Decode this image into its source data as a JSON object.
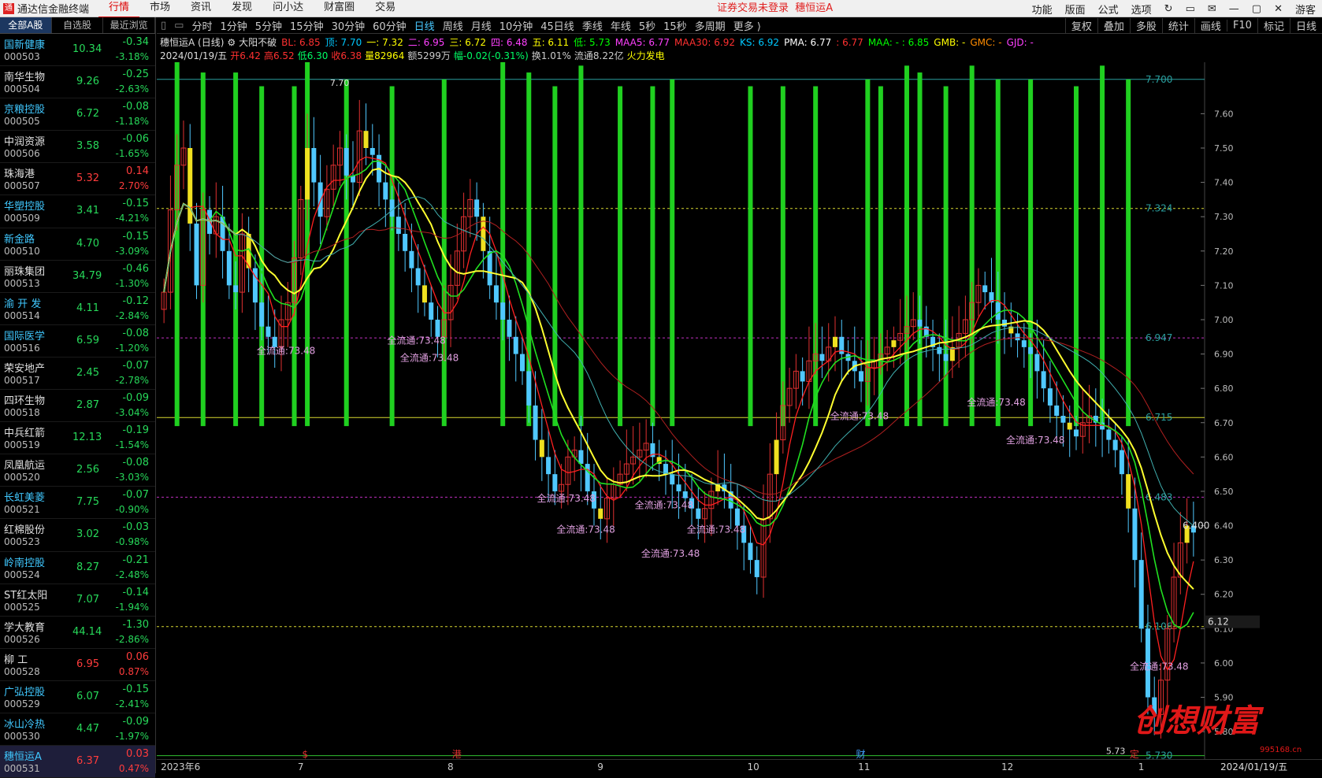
{
  "app": {
    "title": "通达信金融终端",
    "logo": "通"
  },
  "menu": [
    "行情",
    "市场",
    "资讯",
    "发现",
    "问小达",
    "财富圈",
    "交易"
  ],
  "notice": {
    "text": "证券交易未登录",
    "stock": "穗恒运A"
  },
  "right_menu": [
    "功能",
    "版面",
    "公式",
    "选项",
    "游客"
  ],
  "side_tabs": [
    "全部A股",
    "自选股",
    "最近浏览"
  ],
  "stocks": [
    {
      "name": "国新健康",
      "code": "000503",
      "price": "10.34",
      "change": "-0.34",
      "pct": "-3.18%",
      "highlight": true
    },
    {
      "name": "南华生物",
      "code": "000504",
      "price": "9.26",
      "change": "-0.25",
      "pct": "-2.63%"
    },
    {
      "name": "京粮控股",
      "code": "000505",
      "price": "6.72",
      "change": "-0.08",
      "pct": "-1.18%",
      "highlight": true
    },
    {
      "name": "中润资源",
      "code": "000506",
      "price": "3.58",
      "change": "-0.06",
      "pct": "-1.65%"
    },
    {
      "name": "珠海港",
      "code": "000507",
      "price": "5.32",
      "change": "0.14",
      "pct": "2.70%",
      "up": true
    },
    {
      "name": "华塑控股",
      "code": "000509",
      "price": "3.41",
      "change": "-0.15",
      "pct": "-4.21%",
      "highlight": true
    },
    {
      "name": "新金路",
      "code": "000510",
      "price": "4.70",
      "change": "-0.15",
      "pct": "-3.09%",
      "highlight": true
    },
    {
      "name": "丽珠集团",
      "code": "000513",
      "price": "34.79",
      "change": "-0.46",
      "pct": "-1.30%"
    },
    {
      "name": "渝 开 发",
      "code": "000514",
      "price": "4.11",
      "change": "-0.12",
      "pct": "-2.84%",
      "highlight": true
    },
    {
      "name": "国际医学",
      "code": "000516",
      "price": "6.59",
      "change": "-0.08",
      "pct": "-1.20%",
      "highlight": true
    },
    {
      "name": "荣安地产",
      "code": "000517",
      "price": "2.45",
      "change": "-0.07",
      "pct": "-2.78%"
    },
    {
      "name": "四环生物",
      "code": "000518",
      "price": "2.87",
      "change": "-0.09",
      "pct": "-3.04%"
    },
    {
      "name": "中兵红箭",
      "code": "000519",
      "price": "12.13",
      "change": "-0.19",
      "pct": "-1.54%"
    },
    {
      "name": "凤凰航运",
      "code": "000520",
      "price": "2.56",
      "change": "-0.08",
      "pct": "-3.03%"
    },
    {
      "name": "长虹美菱",
      "code": "000521",
      "price": "7.75",
      "change": "-0.07",
      "pct": "-0.90%",
      "highlight": true
    },
    {
      "name": "红棉股份",
      "code": "000523",
      "price": "3.02",
      "change": "-0.03",
      "pct": "-0.98%"
    },
    {
      "name": "岭南控股",
      "code": "000524",
      "price": "8.27",
      "change": "-0.21",
      "pct": "-2.48%",
      "highlight": true
    },
    {
      "name": "ST红太阳",
      "code": "000525",
      "price": "7.07",
      "change": "-0.14",
      "pct": "-1.94%"
    },
    {
      "name": "学大教育",
      "code": "000526",
      "price": "44.14",
      "change": "-1.30",
      "pct": "-2.86%"
    },
    {
      "name": "柳 工",
      "code": "000528",
      "price": "6.95",
      "change": "0.06",
      "pct": "0.87%",
      "up": true
    },
    {
      "name": "广弘控股",
      "code": "000529",
      "price": "6.07",
      "change": "-0.15",
      "pct": "-2.41%",
      "highlight": true
    },
    {
      "name": "冰山冷热",
      "code": "000530",
      "price": "4.47",
      "change": "-0.09",
      "pct": "-1.97%",
      "highlight": true
    },
    {
      "name": "穗恒运A",
      "code": "000531",
      "price": "6.37",
      "change": "0.03",
      "pct": "0.47%",
      "up": true,
      "highlight": true,
      "selected": true
    }
  ],
  "periods": [
    "分时",
    "1分钟",
    "5分钟",
    "15分钟",
    "30分钟",
    "60分钟",
    "日线",
    "周线",
    "月线",
    "10分钟",
    "45日线",
    "季线",
    "年线",
    "5秒",
    "15秒",
    "多周期",
    "更多 ⟩"
  ],
  "active_period": "日线",
  "tools": [
    "复权",
    "叠加",
    "多股",
    "统计",
    "画线",
    "F10",
    "标记",
    "日线"
  ],
  "info": {
    "title": "穗恒运A (日线)",
    "indicator": "大阳不破",
    "items": [
      {
        "t": "BL: 6.85",
        "c": "#ff3030"
      },
      {
        "t": "顶: 7.70",
        "c": "#00c8ff"
      },
      {
        "t": "一: 7.32",
        "c": "#ffff00"
      },
      {
        "t": "二: 6.95",
        "c": "#ff40ff"
      },
      {
        "t": "三: 6.72",
        "c": "#ffff00"
      },
      {
        "t": "四: 6.48",
        "c": "#ff40ff"
      },
      {
        "t": "五: 6.11",
        "c": "#ffff00"
      },
      {
        "t": "低: 5.73",
        "c": "#00ff00"
      },
      {
        "t": "MAA5: 6.77",
        "c": "#ff40ff"
      },
      {
        "t": "MAA30: 6.92",
        "c": "#ff3030"
      },
      {
        "t": "KS: 6.92",
        "c": "#00c8ff"
      },
      {
        "t": "PMA: 6.77",
        "c": "#ffffff"
      },
      {
        "t": ": 6.77",
        "c": "#ff3030"
      },
      {
        "t": "MAA: - : 6.85",
        "c": "#00ff00"
      },
      {
        "t": "GMB: -",
        "c": "#ffff00"
      },
      {
        "t": "GMC: -",
        "c": "#ff8c00"
      },
      {
        "t": "GJD: -",
        "c": "#ff40ff"
      }
    ],
    "date": "2024/01/19/五",
    "stats": [
      {
        "t": "开6.42",
        "c": "#ff3030"
      },
      {
        "t": "高6.52",
        "c": "#ff3030"
      },
      {
        "t": "低6.30",
        "c": "#00ff66"
      },
      {
        "t": "收6.38",
        "c": "#ff3030"
      },
      {
        "t": "量82964",
        "c": "#ffff00"
      },
      {
        "t": "额5299万",
        "c": "#cccccc"
      },
      {
        "t": "幅-0.02(-0.31%)",
        "c": "#00ff66"
      },
      {
        "t": "换1.01%",
        "c": "#cccccc"
      },
      {
        "t": "流通8.22亿",
        "c": "#cccccc"
      },
      {
        "t": "火力发电",
        "c": "#ffff00"
      }
    ]
  },
  "levels": [
    {
      "v": 7.7,
      "label": "7.700",
      "color": "#2aa0a0",
      "style": "solid"
    },
    {
      "v": 7.324,
      "label": "7.324",
      "color": "#d8d830",
      "style": "dash"
    },
    {
      "v": 6.947,
      "label": "6.947",
      "color": "#c030c0",
      "style": "dash"
    },
    {
      "v": 6.715,
      "label": "6.715",
      "color": "#d8d830",
      "style": "solid"
    },
    {
      "v": 6.483,
      "label": "6.483",
      "color": "#c030c0",
      "style": "dash"
    },
    {
      "v": 6.106,
      "label": "6.106",
      "color": "#d8d830",
      "style": "dash"
    },
    {
      "v": 5.73,
      "label": "5.730",
      "color": "#30c030",
      "style": "solid"
    }
  ],
  "y_ticks": [
    "7.60",
    "7.50",
    "7.40",
    "7.30",
    "7.20",
    "7.10",
    "7.00",
    "6.90",
    "6.80",
    "6.70",
    "6.60",
    "6.50",
    "6.40",
    "6.30",
    "6.20",
    "6.10",
    "6.00",
    "5.90",
    "5.80"
  ],
  "current_price": "6.12",
  "last_price_label": "6.400",
  "high_label": "7.70",
  "low_label": "5.73",
  "annotation": "全流通:73.48",
  "x_labels": [
    {
      "t": "2023年6",
      "i": 0
    },
    {
      "t": "7",
      "i": 21
    },
    {
      "t": "8",
      "i": 44
    },
    {
      "t": "9",
      "i": 67
    },
    {
      "t": "10",
      "i": 90
    },
    {
      "t": "11",
      "i": 107
    },
    {
      "t": "12",
      "i": 129
    },
    {
      "t": "1",
      "i": 150
    }
  ],
  "x_markers": [
    {
      "t": "$",
      "i": 20
    },
    {
      "t": "港",
      "i": 43
    },
    {
      "t": "财",
      "i": 105
    },
    {
      "t": "定",
      "i": 147
    }
  ],
  "last_date": "2024/01/19/五",
  "watermark": "创想财富",
  "watermark_url": "995168.cn",
  "chart_data": {
    "type": "candlestick",
    "y_range": [
      5.72,
      7.75
    ],
    "close": [
      7.08,
      7.32,
      7.45,
      7.5,
      7.28,
      7.1,
      7.32,
      7.25,
      7.3,
      7.2,
      7.1,
      7.08,
      7.25,
      7.15,
      7.05,
      6.98,
      6.95,
      6.92,
      7.0,
      7.05,
      7.18,
      7.35,
      7.5,
      7.4,
      7.3,
      7.38,
      7.45,
      7.5,
      7.42,
      7.4,
      7.55,
      7.5,
      7.48,
      7.4,
      7.35,
      7.3,
      7.25,
      7.2,
      7.15,
      7.1,
      7.05,
      7.0,
      6.95,
      7.0,
      7.1,
      7.2,
      7.3,
      7.35,
      7.3,
      7.2,
      7.1,
      7.05,
      7.0,
      6.95,
      6.9,
      6.85,
      6.75,
      6.65,
      6.6,
      6.55,
      6.5,
      6.52,
      6.6,
      6.62,
      6.58,
      6.5,
      6.45,
      6.42,
      6.48,
      6.52,
      6.55,
      6.58,
      6.6,
      6.62,
      6.64,
      6.6,
      6.58,
      6.55,
      6.52,
      6.5,
      6.48,
      6.45,
      6.42,
      6.45,
      6.5,
      6.52,
      6.5,
      6.45,
      6.4,
      6.35,
      6.3,
      6.25,
      6.42,
      6.55,
      6.65,
      6.75,
      6.8,
      6.85,
      6.82,
      6.88,
      6.9,
      6.88,
      6.92,
      6.95,
      6.9,
      6.88,
      6.85,
      6.82,
      6.86,
      6.88,
      6.9,
      6.92,
      6.94,
      6.96,
      6.98,
      7.0,
      6.98,
      6.95,
      6.92,
      6.9,
      6.88,
      6.92,
      6.96,
      7.0,
      7.05,
      7.1,
      7.08,
      7.05,
      7.0,
      6.98,
      6.96,
      6.94,
      6.92,
      6.9,
      6.85,
      6.8,
      6.75,
      6.72,
      6.7,
      6.68,
      6.66,
      6.7,
      6.72,
      6.7,
      6.68,
      6.65,
      6.62,
      6.55,
      6.45,
      6.3,
      6.1,
      5.9,
      5.85,
      5.95,
      6.1,
      6.25,
      6.35,
      6.4,
      6.38
    ],
    "annotation_values": [
      "全流通:73.48"
    ]
  }
}
